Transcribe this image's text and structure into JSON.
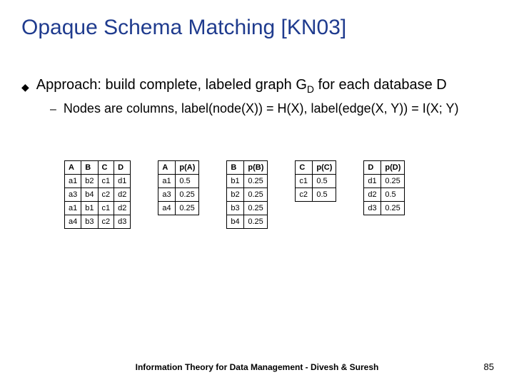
{
  "title": "Opaque Schema Matching [KN03]",
  "bullet": {
    "text_pre": "Approach: build complete, labeled graph G",
    "sub1": "D",
    "text_post": " for each database D"
  },
  "subbullet": "Nodes are columns, label(node(X)) = H(X), label(edge(X, Y)) = I(X; Y)",
  "main_table": {
    "headers": [
      "A",
      "B",
      "C",
      "D"
    ],
    "rows": [
      [
        "a1",
        "b2",
        "c1",
        "d1"
      ],
      [
        "a3",
        "b4",
        "c2",
        "d2"
      ],
      [
        "a1",
        "b1",
        "c1",
        "d2"
      ],
      [
        "a4",
        "b3",
        "c2",
        "d3"
      ]
    ]
  },
  "prob_tables": [
    {
      "col": "A",
      "pcol": "p(A)",
      "rows": [
        [
          "a1",
          "0.5"
        ],
        [
          "a3",
          "0.25"
        ],
        [
          "a4",
          "0.25"
        ]
      ]
    },
    {
      "col": "B",
      "pcol": "p(B)",
      "rows": [
        [
          "b1",
          "0.25"
        ],
        [
          "b2",
          "0.25"
        ],
        [
          "b3",
          "0.25"
        ],
        [
          "b4",
          "0.25"
        ]
      ]
    },
    {
      "col": "C",
      "pcol": "p(C)",
      "rows": [
        [
          "c1",
          "0.5"
        ],
        [
          "c2",
          "0.5"
        ]
      ]
    },
    {
      "col": "D",
      "pcol": "p(D)",
      "rows": [
        [
          "d1",
          "0.25"
        ],
        [
          "d2",
          "0.5"
        ],
        [
          "d3",
          "0.25"
        ]
      ]
    }
  ],
  "footer": "Information Theory for Data Management - Divesh & Suresh",
  "pagenum": "85"
}
